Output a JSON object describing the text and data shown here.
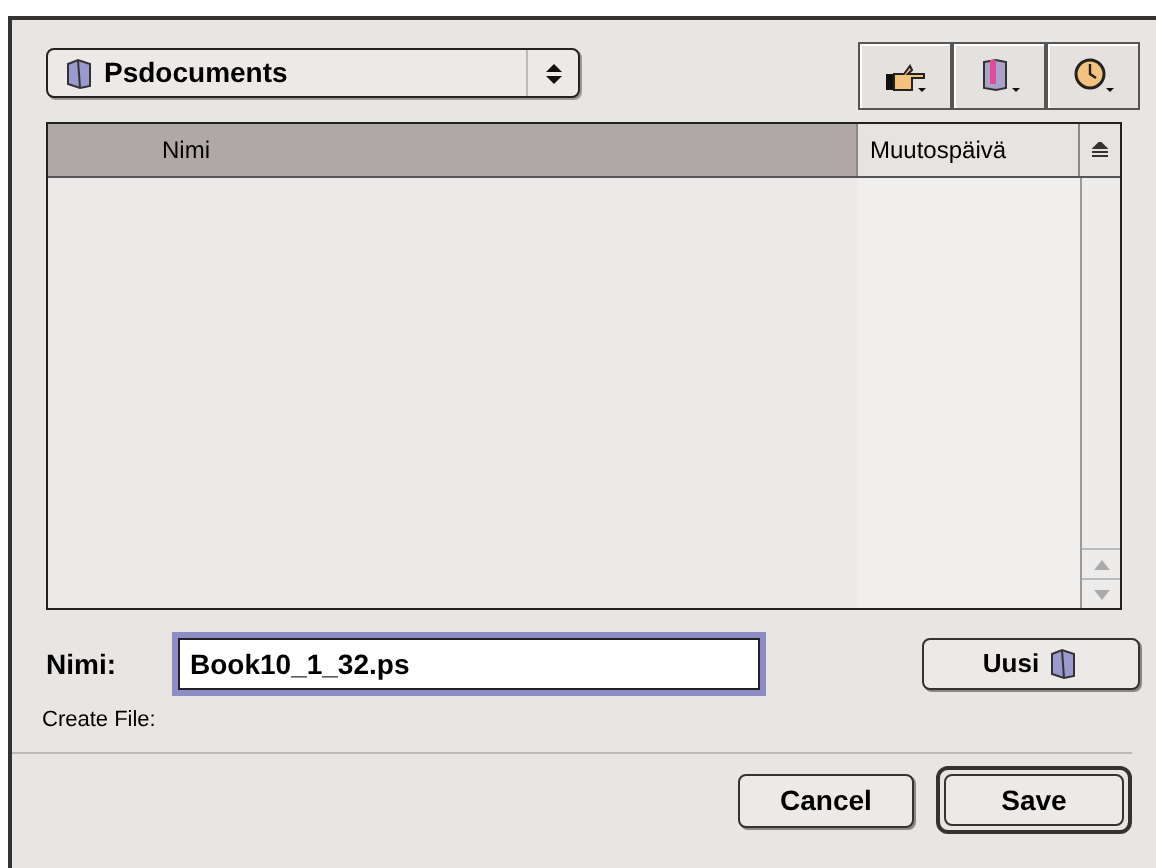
{
  "location_popup": {
    "label": "Psdocuments"
  },
  "toolbar_buttons": [
    {
      "kind": "shortcuts"
    },
    {
      "kind": "favorites"
    },
    {
      "kind": "recent"
    }
  ],
  "file_list": {
    "columns": [
      {
        "label": "Nimi",
        "selected": true
      },
      {
        "label": "Muutospäivä",
        "selected": false
      }
    ]
  },
  "name_field": {
    "label": "Nimi:",
    "value": "Book10_1_32.ps"
  },
  "new_folder_button": {
    "label": "Uusi"
  },
  "status": "Create File:",
  "buttons": [
    {
      "label": "Cancel",
      "default": false
    },
    {
      "label": "Save",
      "default": true
    }
  ]
}
